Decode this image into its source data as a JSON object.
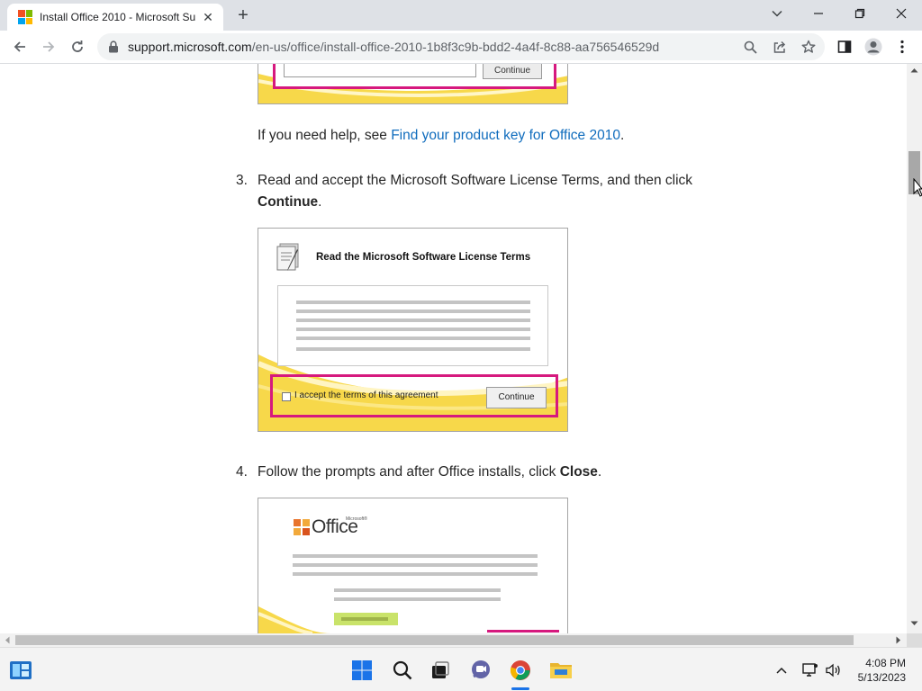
{
  "browser": {
    "tab_title": "Install Office 2010 - Microsoft Su",
    "new_tab_label": "+",
    "url_host": "support.microsoft.com",
    "url_path": "/en-us/office/install-office-2010-1b8f3c9b-bdd2-4a4f-8c88-aa756546529d"
  },
  "content": {
    "top_screenshot": {
      "button_label": "Continue"
    },
    "help_prefix": "If you need help, see ",
    "help_link": "Find your product key for Office 2010",
    "help_suffix": ".",
    "step3": {
      "number": "3.",
      "text_before": "Read and accept the Microsoft Software License Terms, and then click ",
      "bold": "Continue",
      "text_after": "."
    },
    "license_dialog": {
      "title": "Read the Microsoft Software License Terms",
      "checkbox_label": "I accept the terms of this agreement",
      "button_label": "Continue"
    },
    "step4": {
      "number": "4.",
      "text_before": "Follow the prompts and after Office installs, click ",
      "bold": "Close",
      "text_after": "."
    },
    "office_dialog": {
      "logo_text": "Office",
      "logo_small": "Microsoft®"
    }
  },
  "taskbar": {
    "time": "4:08 PM",
    "date": "5/13/2023"
  },
  "colors": {
    "link": "#0f6cbd",
    "highlight": "#d6197e",
    "office_yellow": "#f7d84a"
  }
}
